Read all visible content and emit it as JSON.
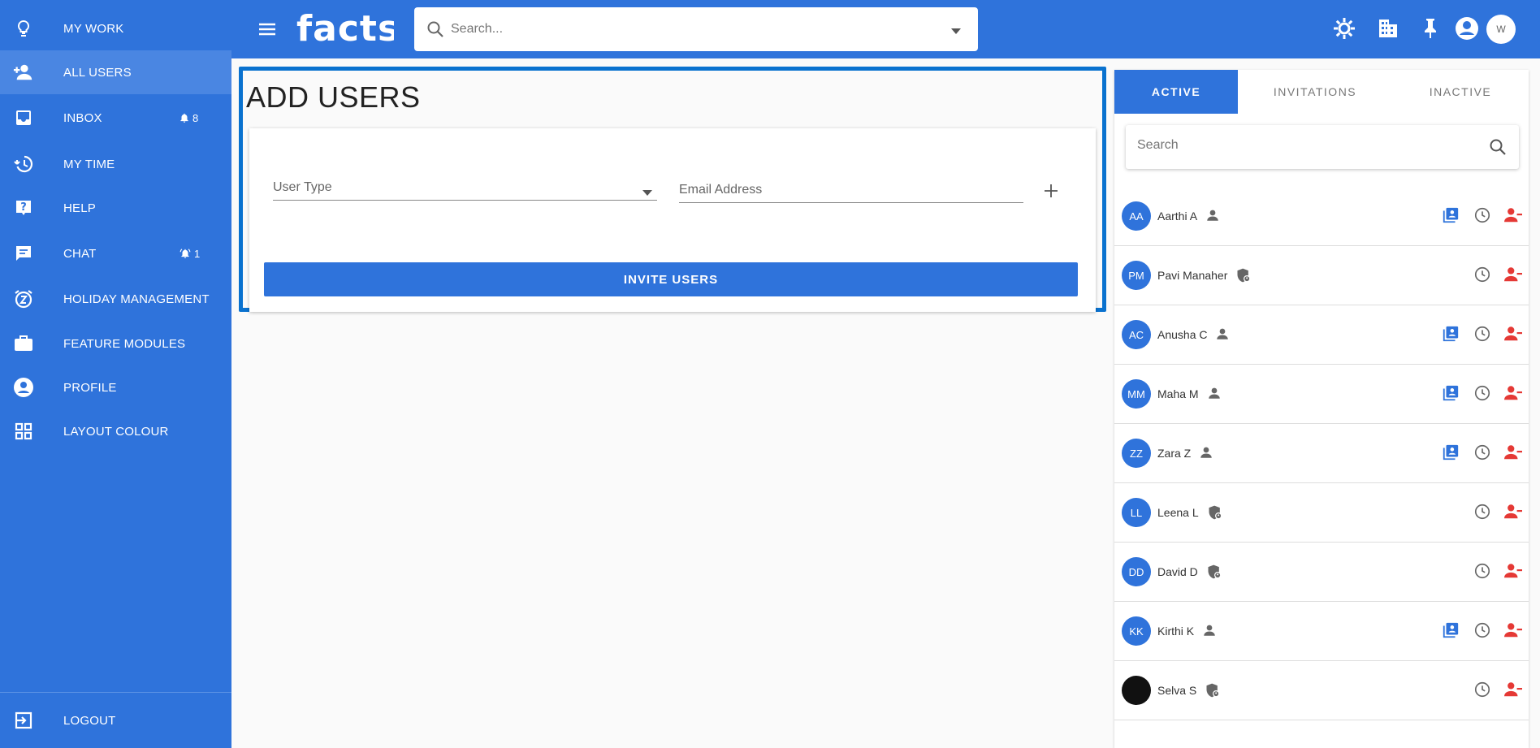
{
  "sidebar": {
    "items": [
      {
        "label": "MY WORK",
        "icon": "lightbulb-icon"
      },
      {
        "label": "ALL USERS",
        "icon": "add-user-icon"
      },
      {
        "label": "INBOX",
        "icon": "inbox-icon",
        "badge": "8"
      },
      {
        "label": "MY TIME",
        "icon": "history-icon"
      },
      {
        "label": "HELP",
        "icon": "help-icon"
      },
      {
        "label": "CHAT",
        "icon": "chat-icon",
        "badge": "1"
      },
      {
        "label": "HOLIDAY MANAGEMENT",
        "icon": "snooze-icon"
      },
      {
        "label": "FEATURE MODULES",
        "icon": "briefcase-icon"
      },
      {
        "label": "PROFILE",
        "icon": "profile-icon"
      },
      {
        "label": "LAYOUT COLOUR",
        "icon": "grid-icon"
      }
    ],
    "logout": "LOGOUT"
  },
  "topbar": {
    "logo": "facts",
    "search_placeholder": "Search...",
    "avatar_initial": "W"
  },
  "main": {
    "title": "ADD USERS",
    "user_type_label": "User Type",
    "email_label": "Email Address",
    "invite_button": "INVITE USERS"
  },
  "right": {
    "tabs": [
      "ACTIVE",
      "INVITATIONS",
      "INACTIVE"
    ],
    "search_placeholder": "Search",
    "users": [
      {
        "initials": "AA",
        "name": "Aarthi A",
        "type": "person-icon",
        "timesheet": true
      },
      {
        "initials": "PM",
        "name": "Pavi Manaher",
        "type": "admin-shield-icon",
        "timesheet": false
      },
      {
        "initials": "AC",
        "name": "Anusha C",
        "type": "person-icon",
        "timesheet": true
      },
      {
        "initials": "MM",
        "name": "Maha M",
        "type": "person-icon",
        "timesheet": true
      },
      {
        "initials": "ZZ",
        "name": "Zara Z",
        "type": "person-icon",
        "timesheet": true
      },
      {
        "initials": "LL",
        "name": "Leena L",
        "type": "admin-shield-icon",
        "timesheet": false
      },
      {
        "initials": "DD",
        "name": "David D",
        "type": "admin-shield-icon",
        "timesheet": false
      },
      {
        "initials": "KK",
        "name": "Kirthi K",
        "type": "person-icon",
        "timesheet": true
      },
      {
        "initials": "",
        "name": "Selva S",
        "type": "admin-shield-icon",
        "timesheet": false,
        "photo": true
      }
    ]
  },
  "colors": {
    "primary": "#2f73db",
    "highlight_border": "#0a72cf",
    "remove": "#e53935"
  }
}
